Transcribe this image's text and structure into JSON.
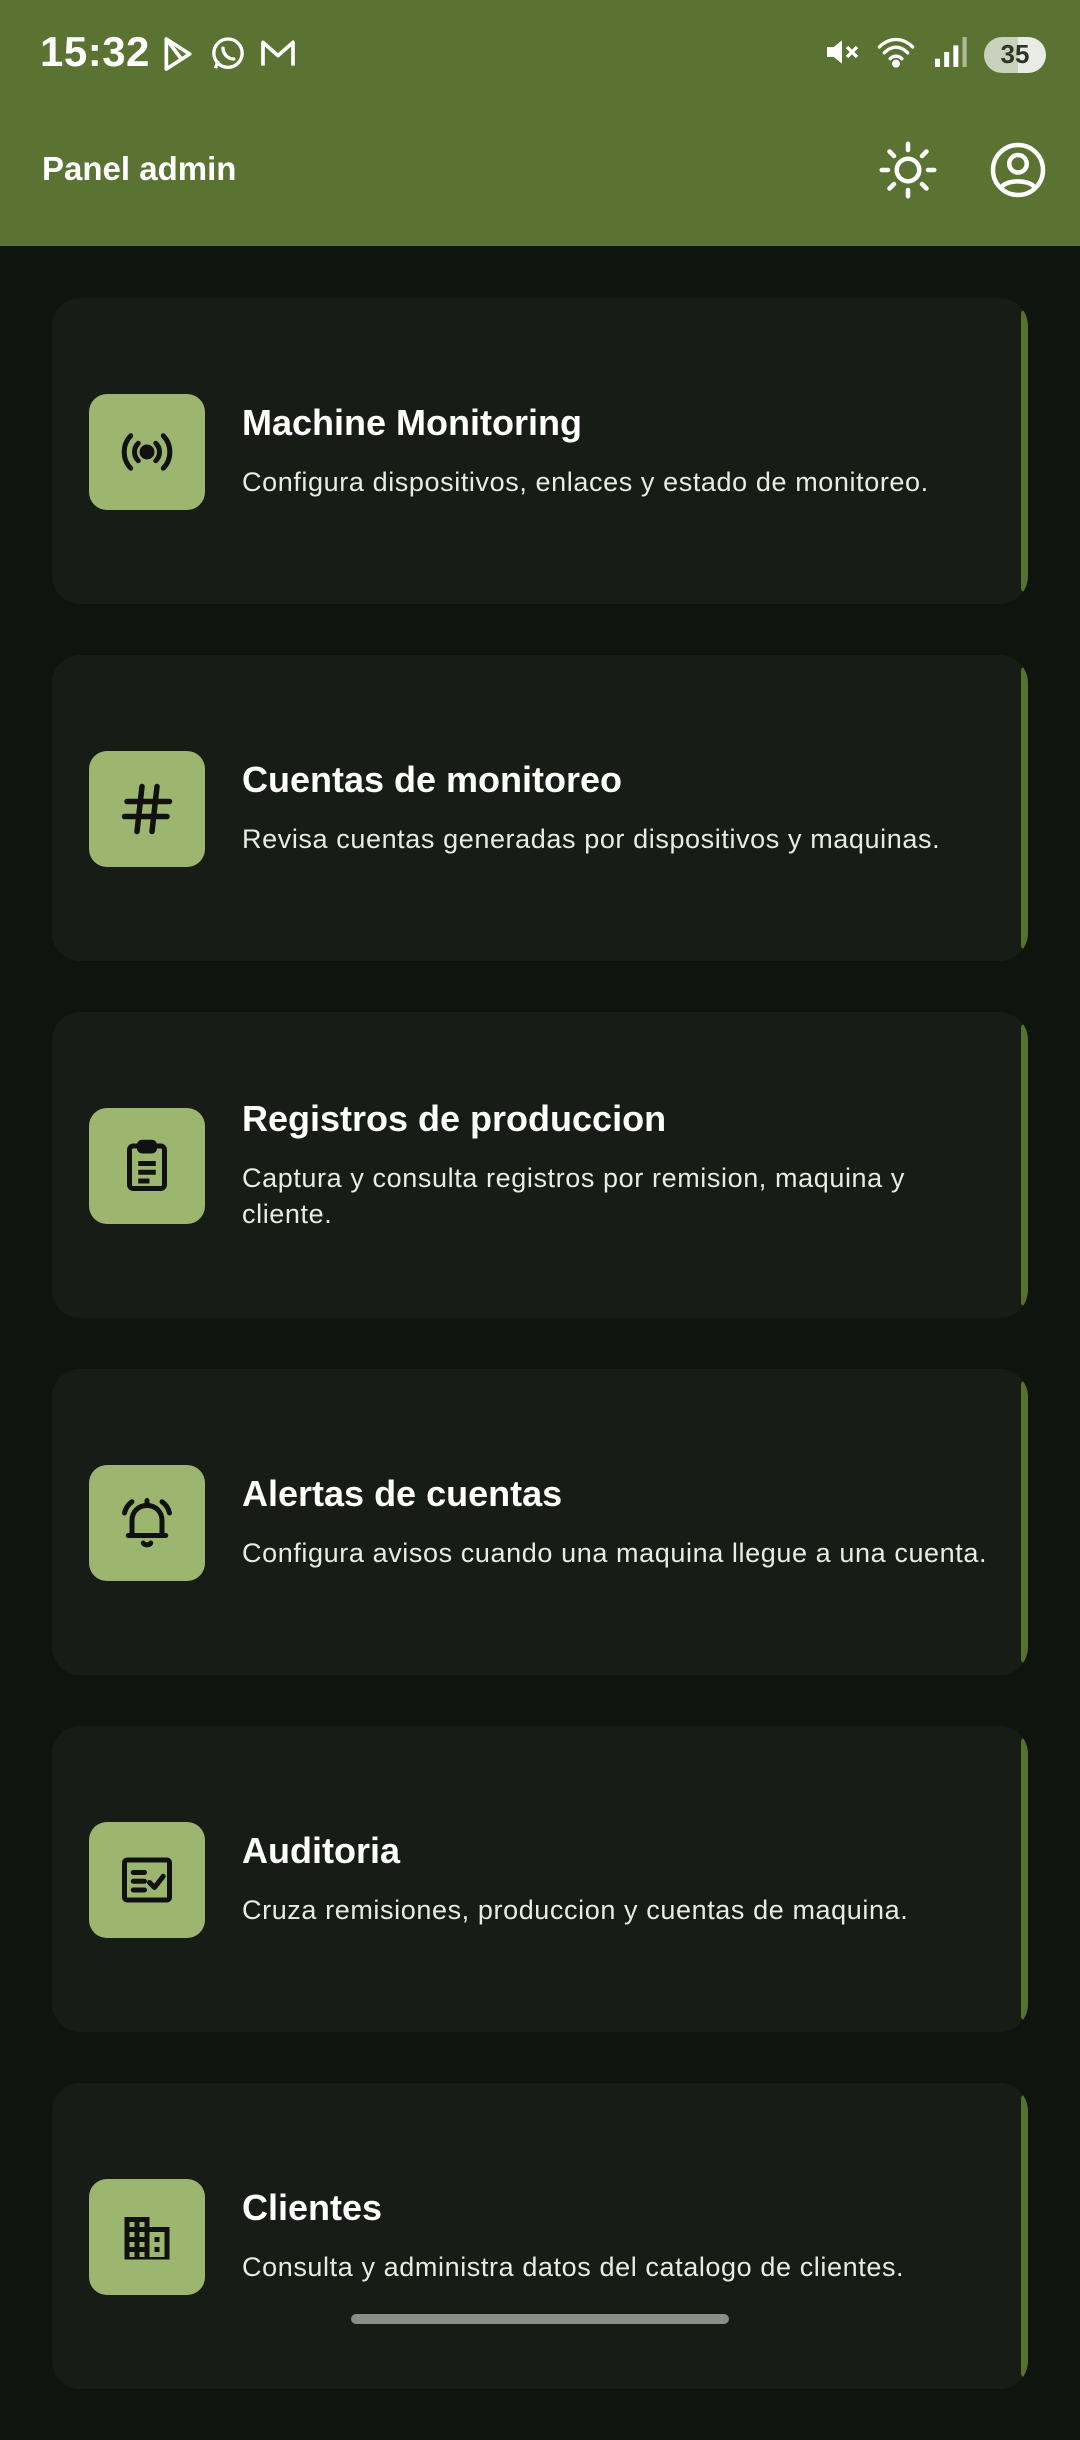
{
  "status_bar": {
    "time": "15:32",
    "notification_icons": [
      "play-store-icon",
      "whatsapp-icon",
      "gmail-icon"
    ],
    "system_icons": [
      "mute-icon",
      "wifi-icon",
      "signal-icon"
    ],
    "battery": "35"
  },
  "appbar": {
    "title": "Panel admin",
    "actions": [
      "theme-toggle-icon",
      "account-icon"
    ]
  },
  "cards": [
    {
      "title": "Machine Monitoring",
      "description": "Configura dispositivos, enlaces y estado de monitoreo.",
      "icon": "broadcast-icon"
    },
    {
      "title": "Cuentas de monitoreo",
      "description": "Revisa cuentas generadas por dispositivos y maquinas.",
      "icon": "hashtag-icon"
    },
    {
      "title": "Registros de produccion",
      "description": "Captura y consulta registros por remision, maquina y cliente.",
      "icon": "clipboard-icon"
    },
    {
      "title": "Alertas de cuentas",
      "description": "Configura avisos cuando una maquina llegue a una cuenta.",
      "icon": "bell-icon"
    },
    {
      "title": "Auditoria",
      "description": "Cruza remisiones, produccion y cuentas de maquina.",
      "icon": "audit-checklist-icon"
    },
    {
      "title": "Clientes",
      "description": "Consulta y administra datos del catalogo de clientes.",
      "icon": "building-icon"
    }
  ],
  "colors": {
    "header": "#5a7332",
    "background": "#0f140e",
    "card": "#181c16",
    "icon_tile": "#9cb66f",
    "accent_edge": "#55702f"
  }
}
